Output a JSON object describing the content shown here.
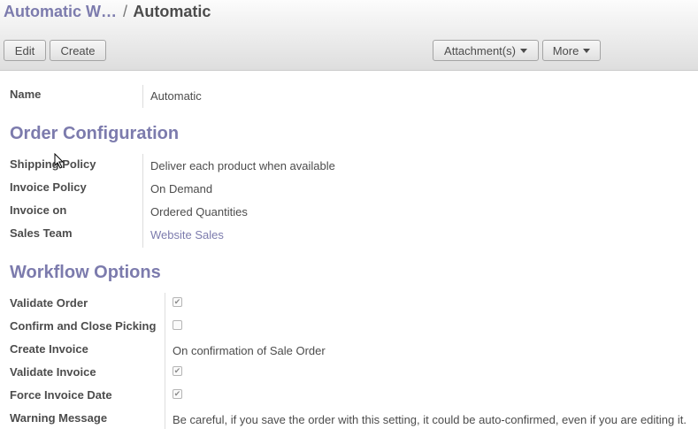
{
  "breadcrumb": {
    "parent": "Automatic W…",
    "separator": "/",
    "current": "Automatic"
  },
  "toolbar": {
    "edit_label": "Edit",
    "create_label": "Create",
    "attachments_label": "Attachment(s)",
    "more_label": "More"
  },
  "fields": {
    "name_label": "Name",
    "name_value": "Automatic"
  },
  "order_configuration": {
    "title": "Order Configuration",
    "shipping_policy_label": "Shipping Policy",
    "shipping_policy_value": "Deliver each product when available",
    "invoice_policy_label": "Invoice Policy",
    "invoice_policy_value": "On Demand",
    "invoice_on_label": "Invoice on",
    "invoice_on_value": "Ordered Quantities",
    "sales_team_label": "Sales Team",
    "sales_team_value": "Website Sales"
  },
  "workflow_options": {
    "title": "Workflow Options",
    "validate_order_label": "Validate Order",
    "validate_order_checked": true,
    "confirm_close_picking_label": "Confirm and Close Picking",
    "confirm_close_picking_checked": false,
    "create_invoice_label": "Create Invoice",
    "create_invoice_value": "On confirmation of Sale Order",
    "validate_invoice_label": "Validate Invoice",
    "validate_invoice_checked": true,
    "force_invoice_date_label": "Force Invoice Date",
    "force_invoice_date_checked": true,
    "warning_message_label": "Warning Message",
    "warning_message_value": "Be careful, if you save the order with this setting, it could be auto-confirmed, even if you are editing it."
  },
  "colors": {
    "accent": "#7c7bad",
    "text": "#4c4c4c"
  }
}
